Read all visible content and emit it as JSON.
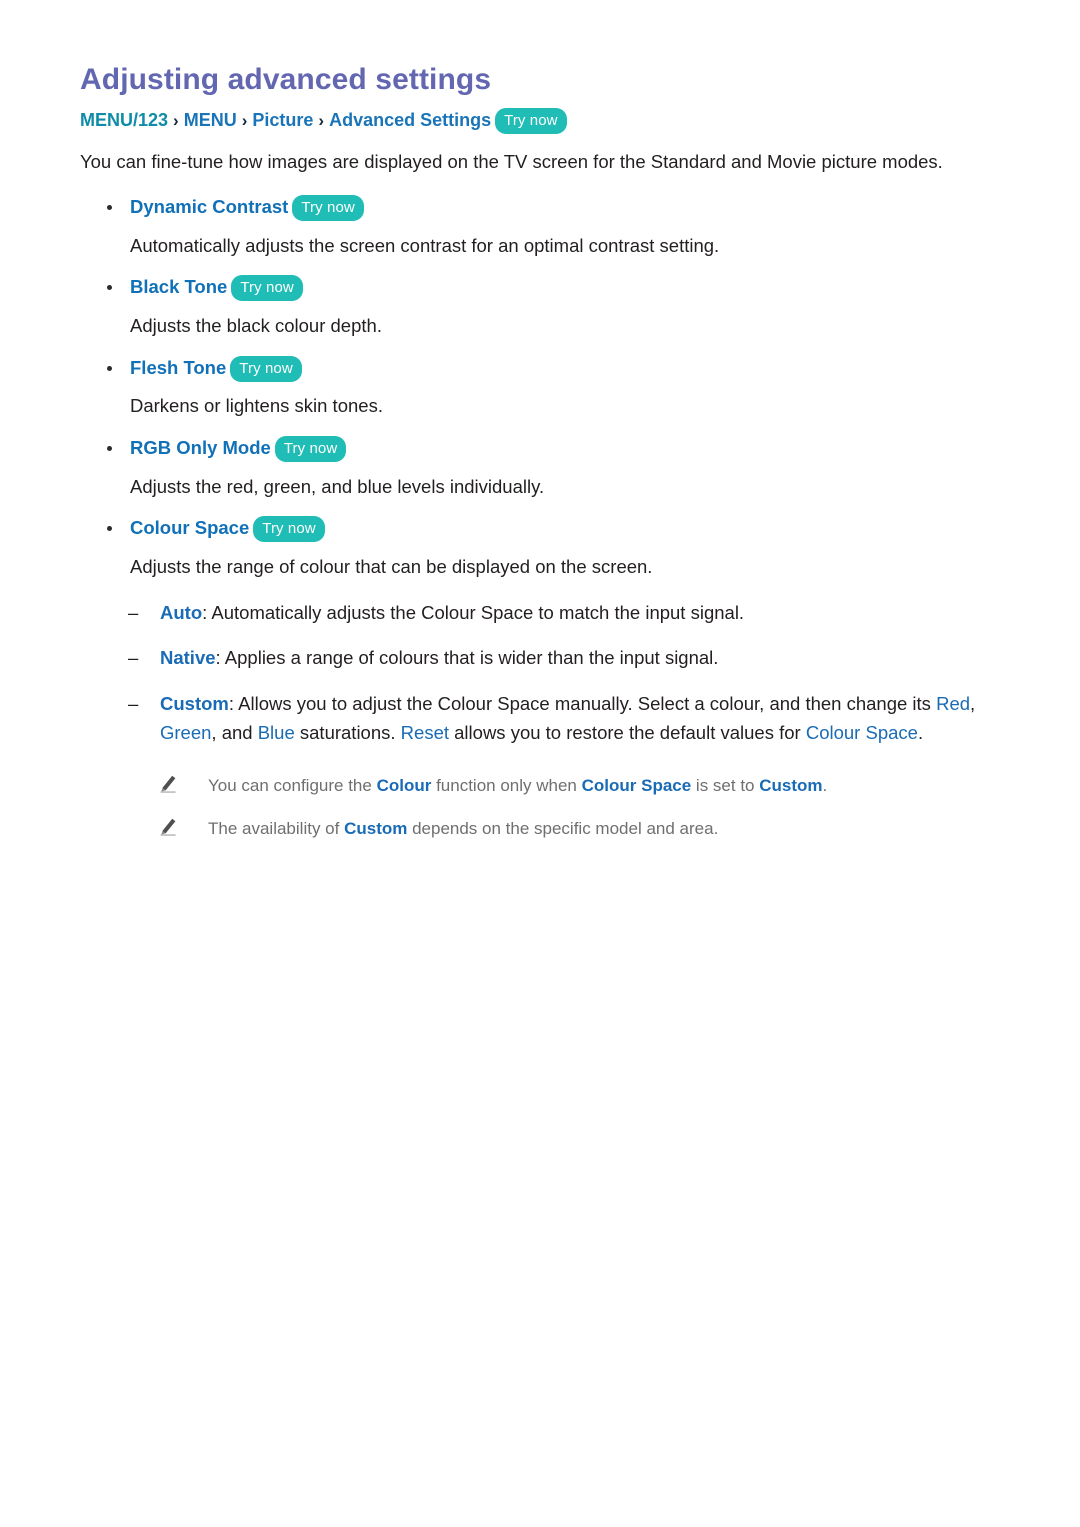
{
  "page": {
    "title": "Adjusting advanced settings",
    "title_color": "#6366b0",
    "accent_blue": "#1070b8",
    "accent_teal": "#20bdb6",
    "body_color": "#231f20",
    "note_color": "#6f6f6f"
  },
  "breadcrumb": {
    "items": [
      "MENU/123",
      "MENU",
      "Picture",
      "Advanced Settings"
    ],
    "separator": "›",
    "try_now": "Try now"
  },
  "intro": "You can fine-tune how images are displayed on the TV screen for the Standard and Movie picture modes.",
  "bullets": [
    {
      "label": "Dynamic Contrast",
      "try_now": "Try now",
      "description": "Automatically adjusts the screen contrast for an optimal contrast setting."
    },
    {
      "label": "Black Tone",
      "try_now": "Try now",
      "description": "Adjusts the black colour depth."
    },
    {
      "label": "Flesh Tone",
      "try_now": "Try now",
      "description": "Darkens or lightens skin tones."
    },
    {
      "label": "RGB Only Mode",
      "try_now": "Try now",
      "description": "Adjusts the red, green, and blue levels individually."
    },
    {
      "label": "Colour Space",
      "try_now": "Try now",
      "description": "Adjusts the range of colour that can be displayed on the screen."
    }
  ],
  "sub_items": {
    "dash": "–",
    "auto": {
      "term": "Auto",
      "colon": ":",
      "text": " Automatically adjusts the Colour Space to match the input signal."
    },
    "native": {
      "term": "Native",
      "colon": ":",
      "text": " Applies a range of colours that is wider than the input signal."
    },
    "custom": {
      "term": "Custom",
      "colon": ":",
      "text_1": " Allows you to adjust the Colour Space manually. Select a colour, and then change its ",
      "hl_red": "Red",
      "sep_1": ", ",
      "hl_green": "Green",
      "sep_2": ", and ",
      "hl_blue": "Blue",
      "text_2": " saturations. ",
      "hl_reset": "Reset",
      "text_3": " allows you to restore the default values for ",
      "hl_colour_space": "Colour Space",
      "text_4": "."
    }
  },
  "notes": {
    "icon": "pencil-icon",
    "note_1": {
      "text_1": "You can configure the ",
      "hl_1": "Colour",
      "text_2": " function only when ",
      "hl_2": "Colour Space",
      "text_3": " is set to ",
      "hl_3": "Custom",
      "text_4": "."
    },
    "note_2": {
      "text_1": "The availability of ",
      "hl_1": "Custom",
      "text_2": " depends on the specific model and area."
    }
  }
}
